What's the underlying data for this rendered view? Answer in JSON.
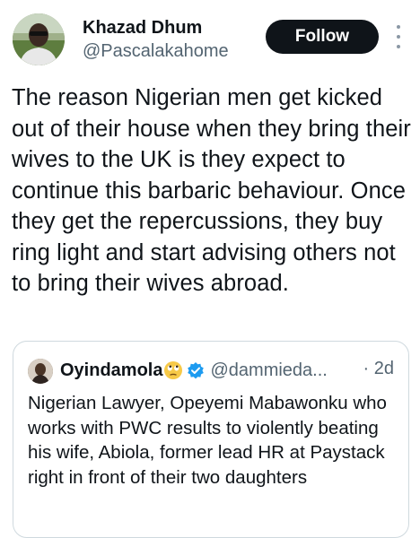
{
  "author": {
    "name": "Khazad Dhum",
    "handle": "@Pascalakahome"
  },
  "actions": {
    "follow_label": "Follow"
  },
  "tweet": {
    "text": "The reason Nigerian men get kicked out of their house when they bring their wives to the UK is they expect to continue this barbaric behaviour. Once they get the repercussions, they buy ring light and start advising others not to bring their wives abroad."
  },
  "quote": {
    "name": "Oyindamola",
    "name_emoji": "face-with-rolling-eyes",
    "verified": true,
    "handle": "@dammieda...",
    "time": "· 2d",
    "text": "Nigerian Lawyer, Opeyemi Mabawonku who works with PWC results to violently beating his wife, Abiola, former lead HR at Paystack right in front of their two daughters"
  },
  "colors": {
    "text_primary": "#0f1419",
    "text_secondary": "#536471",
    "follow_bg": "#0f1419",
    "verified_blue": "#1d9bf0",
    "card_border": "#cfd9de"
  },
  "icons": {
    "more": "more-vertical-icon",
    "verified": "verified-badge-icon"
  }
}
